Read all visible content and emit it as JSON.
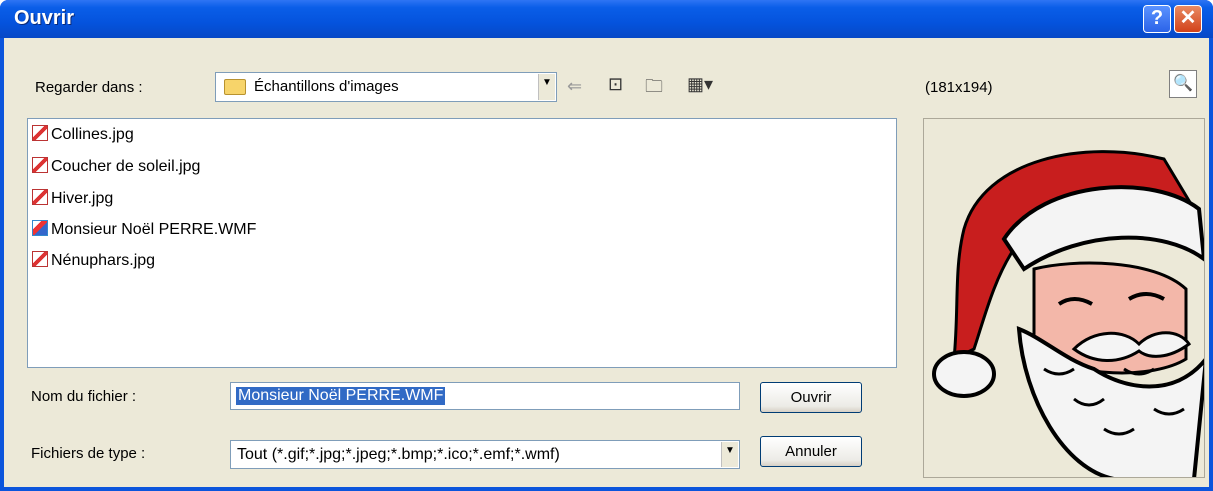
{
  "window": {
    "title": "Ouvrir"
  },
  "titlebar_buttons": {
    "help": "?",
    "close": "✕"
  },
  "toolbar": {
    "look_in_label": "Regarder dans :",
    "look_in_value": "Échantillons d'images"
  },
  "files": [
    {
      "name": "Collines.jpg",
      "icon": "jpg-image-icon"
    },
    {
      "name": "Coucher de soleil.jpg",
      "icon": "jpg-image-icon"
    },
    {
      "name": "Hiver.jpg",
      "icon": "jpg-image-icon"
    },
    {
      "name": "Monsieur Noël PERRE.WMF",
      "icon": "wmf-image-icon"
    },
    {
      "name": "Nénuphars.jpg",
      "icon": "jpg-image-icon"
    }
  ],
  "filename": {
    "label": "Nom du fichier :",
    "value": "Monsieur Noël PERRE.WMF"
  },
  "filetype": {
    "label": "Fichiers de type :",
    "value": "Tout (*.gif;*.jpg;*.jpeg;*.bmp;*.ico;*.emf;*.wmf)"
  },
  "buttons": {
    "open": "Ouvrir",
    "cancel": "Annuler"
  },
  "preview": {
    "dimensions": "(181x194)"
  }
}
